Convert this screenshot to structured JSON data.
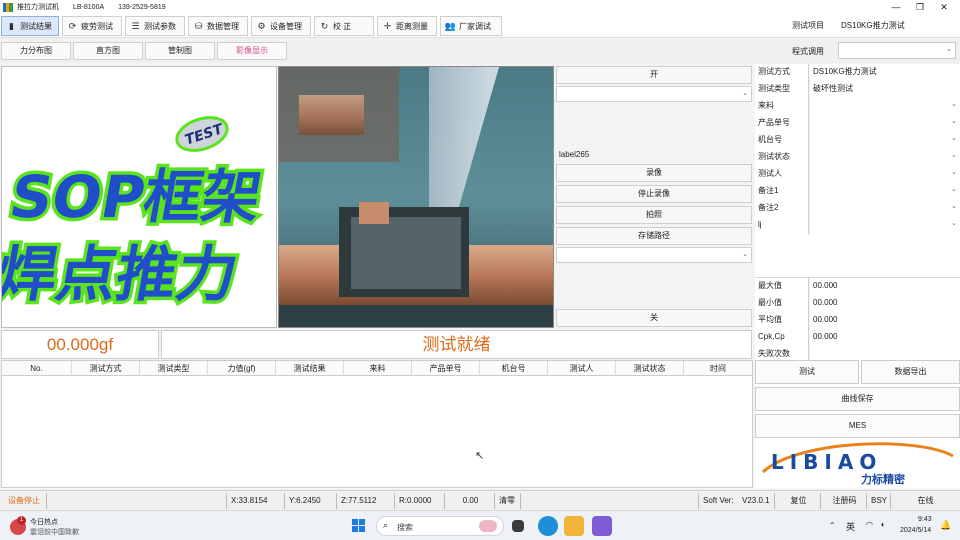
{
  "titlebar": {
    "app": "推拉力测试机",
    "model": "LB-8100A",
    "phone": "139-2529-5819"
  },
  "toolbar": {
    "buttons": [
      "测试结果",
      "疲劳测试",
      "测试参数",
      "数据管理",
      "设备管理",
      "校 正",
      "距离测量",
      "厂家调试"
    ],
    "project_label": "测试项目",
    "project_value": "DS10KG推力测试",
    "program_label": "程式调用"
  },
  "tabs": [
    "力分布图",
    "直方图",
    "管制图",
    "影像显示"
  ],
  "overlay": {
    "line1": "SOP框架",
    "line2": "焊点推力",
    "badge": "TEST"
  },
  "camera_controls": {
    "open": "开",
    "label": "label265",
    "record": "录像",
    "stop_record": "停止录像",
    "photo": "拍照",
    "save_path": "存储路径",
    "close": "关"
  },
  "info_rows": [
    {
      "k": "测试方式",
      "v": "DS10KG推力测试"
    },
    {
      "k": "测试类型",
      "v": "破坏性测试"
    },
    {
      "k": "来料",
      "v": ""
    },
    {
      "k": "产品单号",
      "v": ""
    },
    {
      "k": "机台号",
      "v": ""
    },
    {
      "k": "测试状态",
      "v": ""
    },
    {
      "k": "测试人",
      "v": ""
    },
    {
      "k": "备注1",
      "v": ""
    },
    {
      "k": "备注2",
      "v": ""
    },
    {
      "k": "lj",
      "v": ""
    }
  ],
  "stats": [
    {
      "k": "最大值",
      "v": "00.000"
    },
    {
      "k": "最小值",
      "v": "00.000"
    },
    {
      "k": "平均值",
      "v": "00.000"
    },
    {
      "k": "Cpk,Cp",
      "v": "00.000"
    },
    {
      "k": "失败次数",
      "v": ""
    }
  ],
  "readout": {
    "force": "00.000gf",
    "status": "测试就绪"
  },
  "table_headers": [
    "No.",
    "测试方式",
    "测试类型",
    "力值(gf)",
    "测试结果",
    "来料",
    "产品单号",
    "机台号",
    "测试人",
    "测试状态",
    "时间"
  ],
  "actions": {
    "test": "测试",
    "export": "数据导出",
    "save_curve": "曲线保存",
    "mes": "MES"
  },
  "logo": {
    "latin": "LIBIAO",
    "cn": "力标精密"
  },
  "statusbar": {
    "device": "设备停止",
    "x": "X:33.8154",
    "y": "Y:6.2450",
    "z": "Z:77.5112",
    "r": "R:0.0000",
    "val": "0.00",
    "zero": "清零",
    "soft_label": "Soft Ver:",
    "soft_ver": "V23.0.1",
    "reset": "复位",
    "register": "注册码",
    "bsy": "BSY",
    "online": "在线"
  },
  "taskbar": {
    "news_title": "今日热点",
    "news_sub": "震泪前中国致歉",
    "badge": "1",
    "search": "搜索",
    "lang": "英",
    "time": "9:43",
    "date": "2024/5/14"
  },
  "colors": {
    "accent_orange": "#e06a1a",
    "overlay_blue": "#1f4ec8",
    "overlay_green": "#5be31e",
    "logo_blue": "#1a4aa0",
    "logo_orange": "#e8821c"
  }
}
